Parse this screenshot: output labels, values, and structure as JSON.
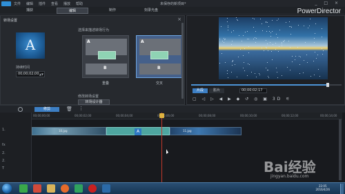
{
  "titlebar": {
    "menu": [
      "文件",
      "编辑",
      "插件",
      "查看",
      "播放",
      "帮助"
    ],
    "document_title": "未保存的新项目*",
    "controls": "_ □ ×"
  },
  "tabs": [
    {
      "label": "捕获",
      "active": false
    },
    {
      "label": "编辑",
      "active": true
    },
    {
      "label": "制作",
      "active": false
    },
    {
      "label": "刻录光盘",
      "active": false
    }
  ],
  "brand": "PowerDirector",
  "transition_panel": {
    "title": "转场设置",
    "close": "×",
    "preview_letter": "A",
    "duration_label": "持续时间",
    "duration_value": "00;00;02;00",
    "behavior_label": "选择来描述转场行为",
    "modes": [
      {
        "label": "重叠",
        "selected": false
      },
      {
        "label": "交叉",
        "selected": true
      }
    ],
    "designer_label": "修改转场设置",
    "designer_button": "转场设计器",
    "reset_button": "重置"
  },
  "preview": {
    "mode_clip": "片段",
    "mode_movie": "影片",
    "timecode": "00;00;02;17",
    "playback_progress": 0.91,
    "controls": "▢ ◁ ▷ ◀ ▶ ◆ ↺ ◎ ▣ 3D ⚟"
  },
  "toolbar": {
    "edit_label": "修剪"
  },
  "timeline": {
    "ticks": [
      "00;00;00;00",
      "00;00;02;00",
      "00;00;04;00",
      "00;00;06;00",
      "00;00;08;00",
      "00;00;10;00",
      "00;00;12;00",
      "00;00;14;00"
    ],
    "tracks": [
      "1.",
      "",
      "1.",
      "fx",
      "2.",
      "2.",
      "T",
      ""
    ],
    "clip1_label": "10.jpg",
    "clip2_label": "11.jpg"
  },
  "taskbar": {
    "time": "22:05",
    "date": "2016/4/26"
  },
  "watermark": {
    "text": "Bai经验",
    "url": "jingyan.baidu.com"
  },
  "colors": {
    "accent": "#3d7fc4",
    "transition": "#4ea6a0",
    "playhead": "#c0392b"
  }
}
